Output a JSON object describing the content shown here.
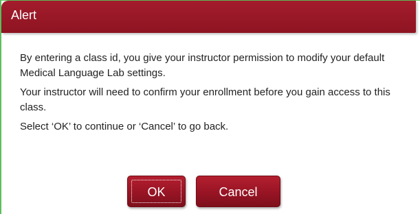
{
  "dialog": {
    "title": "Alert",
    "paragraphs": [
      "By entering a class id, you give your instructor permission to modify your default Medical Language Lab settings.",
      "Your instructor will need to confirm your enrollment before you gain access to this class.",
      "Select ‘OK’ to continue or ‘Cancel’ to go back."
    ],
    "ok_label": "OK",
    "cancel_label": "Cancel"
  },
  "colors": {
    "header": "#9a1828",
    "button": "#9a1525",
    "frame_border": "#5cbf5c"
  }
}
